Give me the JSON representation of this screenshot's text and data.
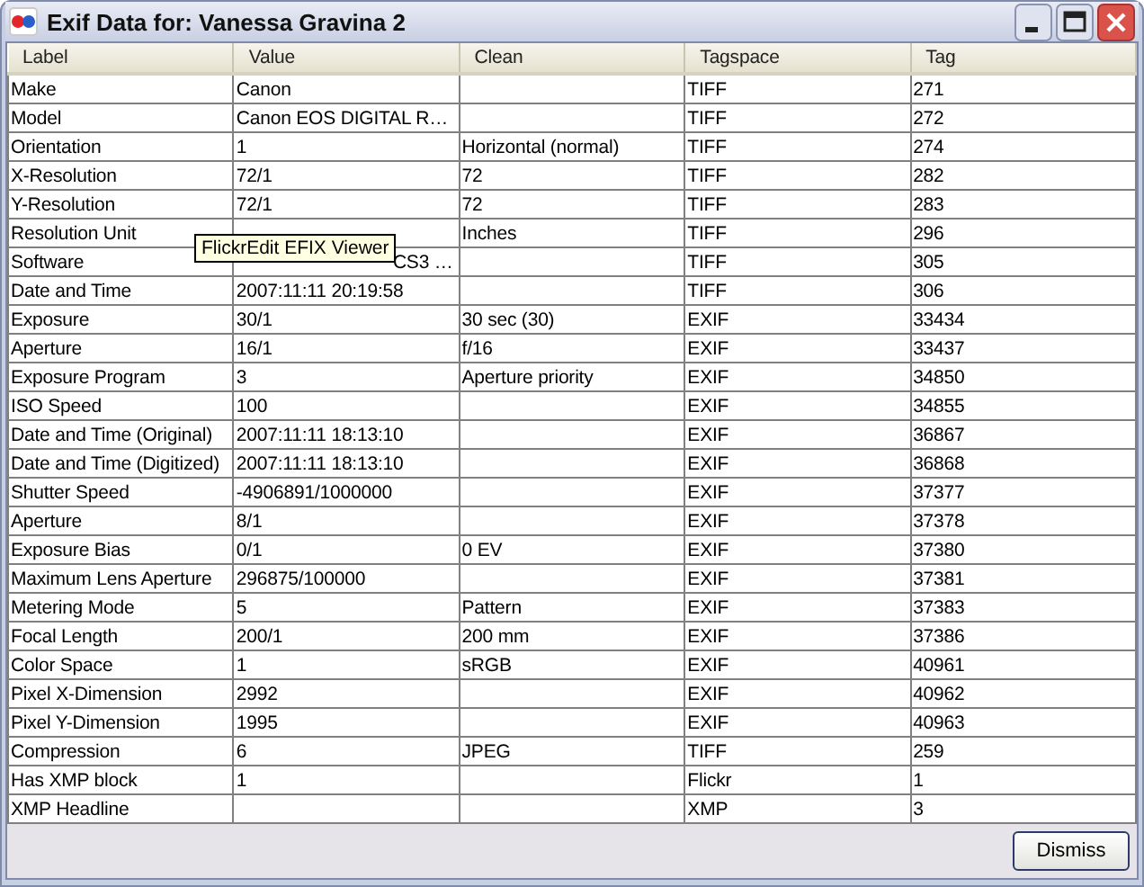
{
  "window": {
    "title": "Exif Data for: Vanessa Gravina  2"
  },
  "table": {
    "columns": [
      "Label",
      "Value",
      "Clean",
      "Tagspace",
      "Tag"
    ],
    "rows": [
      [
        "Make",
        "Canon",
        "",
        "TIFF",
        "271"
      ],
      [
        "Model",
        "Canon EOS DIGITAL R…",
        "",
        "TIFF",
        "272"
      ],
      [
        "Orientation",
        "1",
        "Horizontal (normal)",
        "TIFF",
        "274"
      ],
      [
        "X-Resolution",
        "72/1",
        "72",
        "TIFF",
        "282"
      ],
      [
        "Y-Resolution",
        "72/1",
        "72",
        "TIFF",
        "283"
      ],
      [
        "Resolution Unit",
        "",
        "Inches",
        "TIFF",
        "296"
      ],
      [
        "Software",
        {
          "text": "CS3 …",
          "covered": true
        },
        "",
        "TIFF",
        "305"
      ],
      [
        "Date and Time",
        "2007:11:11 20:19:58",
        "",
        "TIFF",
        "306"
      ],
      [
        "Exposure",
        "30/1",
        "30 sec (30)",
        "EXIF",
        "33434"
      ],
      [
        "Aperture",
        "16/1",
        "f/16",
        "EXIF",
        "33437"
      ],
      [
        "Exposure Program",
        "3",
        "Aperture priority",
        "EXIF",
        "34850"
      ],
      [
        "ISO Speed",
        "100",
        "",
        "EXIF",
        "34855"
      ],
      [
        "Date and Time (Original)",
        "2007:11:11 18:13:10",
        "",
        "EXIF",
        "36867"
      ],
      [
        "Date and Time (Digitized)",
        "2007:11:11 18:13:10",
        "",
        "EXIF",
        "36868"
      ],
      [
        "Shutter Speed",
        "-4906891/1000000",
        "",
        "EXIF",
        "37377"
      ],
      [
        "Aperture",
        "8/1",
        "",
        "EXIF",
        "37378"
      ],
      [
        "Exposure Bias",
        "0/1",
        "0 EV",
        "EXIF",
        "37380"
      ],
      [
        "Maximum Lens Aperture",
        "296875/100000",
        "",
        "EXIF",
        "37381"
      ],
      [
        "Metering Mode",
        "5",
        "Pattern",
        "EXIF",
        "37383"
      ],
      [
        "Focal Length",
        "200/1",
        "200 mm",
        "EXIF",
        "37386"
      ],
      [
        "Color Space",
        "1",
        "sRGB",
        "EXIF",
        "40961"
      ],
      [
        "Pixel X-Dimension",
        "2992",
        "",
        "EXIF",
        "40962"
      ],
      [
        "Pixel Y-Dimension",
        "1995",
        "",
        "EXIF",
        "40963"
      ],
      [
        "Compression",
        "6",
        "JPEG",
        "TIFF",
        "259"
      ],
      [
        "Has XMP block",
        "1",
        "",
        "Flickr",
        "1"
      ],
      [
        "XMP Headline",
        "",
        "",
        "XMP",
        "3"
      ]
    ]
  },
  "tooltip": "FlickrEdit EFIX Viewer",
  "buttons": [
    "Dismiss"
  ]
}
